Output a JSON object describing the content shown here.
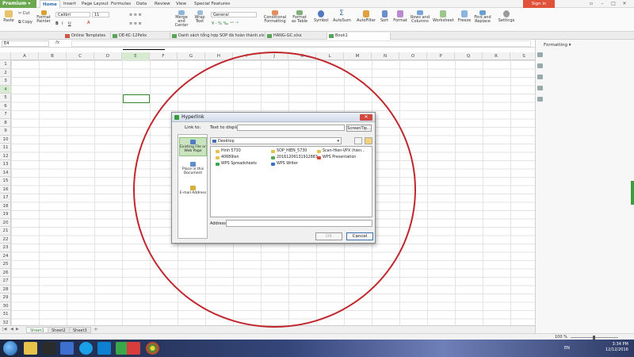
{
  "app": {
    "name": "Premium",
    "menu_tabs": [
      "Home",
      "Insert",
      "Page Layout",
      "Formulas",
      "Data",
      "Review",
      "View",
      "Special Features"
    ],
    "active_tab": "Home",
    "signin_label": "Sign in"
  },
  "ribbon": {
    "paste": "Paste",
    "cut": "Cut",
    "copy": "Copy",
    "format_painter": "Format Painter",
    "font_name": "Calibri",
    "font_size": "11",
    "merge_center": "Merge and Center",
    "wrap_text": "Wrap Text",
    "number_format": "General",
    "conditional_formatting": "Conditional Formatting",
    "format_as_table": "Format as Table",
    "symbol": "Symbol",
    "autosum": "AutoSum",
    "autofilter": "AutoFilter",
    "sort": "Sort",
    "format": "Format",
    "rows_columns": "Rows and Columns",
    "worksheet": "Worksheet",
    "freeze": "Freeze",
    "find_replace": "Find and Replace",
    "settings": "Settings"
  },
  "doc_tabs": [
    {
      "label": "Online Templates",
      "active": false
    },
    {
      "label": "DE-KC-12Pelix",
      "active": false
    },
    {
      "label": "Danh sách tổng hợp SOP đã hoàn thành.xls",
      "active": false
    },
    {
      "label": "HANG-GC.xlsx",
      "active": false
    },
    {
      "label": "Book1",
      "active": true
    }
  ],
  "formula_bar": {
    "name_box": "E4",
    "fx": "fx",
    "value": ""
  },
  "grid": {
    "columns": [
      "A",
      "B",
      "C",
      "D",
      "E",
      "F",
      "G",
      "H",
      "I",
      "J",
      "K",
      "L",
      "M",
      "N",
      "O",
      "P",
      "Q",
      "R",
      "S"
    ],
    "rows": [
      "1",
      "2",
      "3",
      "4",
      "5",
      "6",
      "7",
      "8",
      "9",
      "10",
      "11",
      "12",
      "13",
      "14",
      "15",
      "16",
      "17",
      "18",
      "19",
      "20",
      "21",
      "22",
      "23",
      "24",
      "25",
      "26",
      "27",
      "28",
      "29",
      "30",
      "31",
      "32"
    ],
    "selected_column": "E",
    "selected_row": "4"
  },
  "side_panel": {
    "title": "Formatting"
  },
  "sheets": {
    "tabs": [
      "Sheet1",
      "Sheet2",
      "Sheet3"
    ],
    "active": "Sheet1",
    "add_label": "+"
  },
  "status": {
    "zoom": "100 %"
  },
  "dialog": {
    "title": "Hyperlink",
    "link_to_label": "Link to:",
    "text_to_display_label": "Text to display:",
    "text_to_display_value": "",
    "screentip_button": "ScreenTip...",
    "link_options": [
      {
        "label": "Existing File or Web Page",
        "active": true
      },
      {
        "label": "Place in this Document",
        "active": false
      },
      {
        "label": "E-mail Address",
        "active": false
      }
    ],
    "folder": "Desktop",
    "files": [
      {
        "name": "Hinh 5730",
        "type": "folder"
      },
      {
        "name": "SOP_HIEN_5730",
        "type": "folder"
      },
      {
        "name": "Scan-Hien-VPX (hien...",
        "type": "folder"
      },
      {
        "name": "40689len",
        "type": "folder"
      },
      {
        "name": "20161206131912883",
        "type": "file"
      },
      {
        "name": "WPS Presentation",
        "type": "app-red"
      },
      {
        "name": "WPS Spreadsheets",
        "type": "app-green"
      },
      {
        "name": "WPS Writer",
        "type": "app-blue"
      }
    ],
    "address_label": "Address:",
    "address_value": "",
    "ok_button": "OK",
    "cancel_button": "Cancel"
  },
  "taskbar": {
    "lang": "EN",
    "time": "3:34 PM",
    "date": "12/12/2016"
  },
  "colors": {
    "accent_green": "#3a8a3a",
    "annotation_red": "#c0272d",
    "signin_orange": "#e0533a"
  }
}
